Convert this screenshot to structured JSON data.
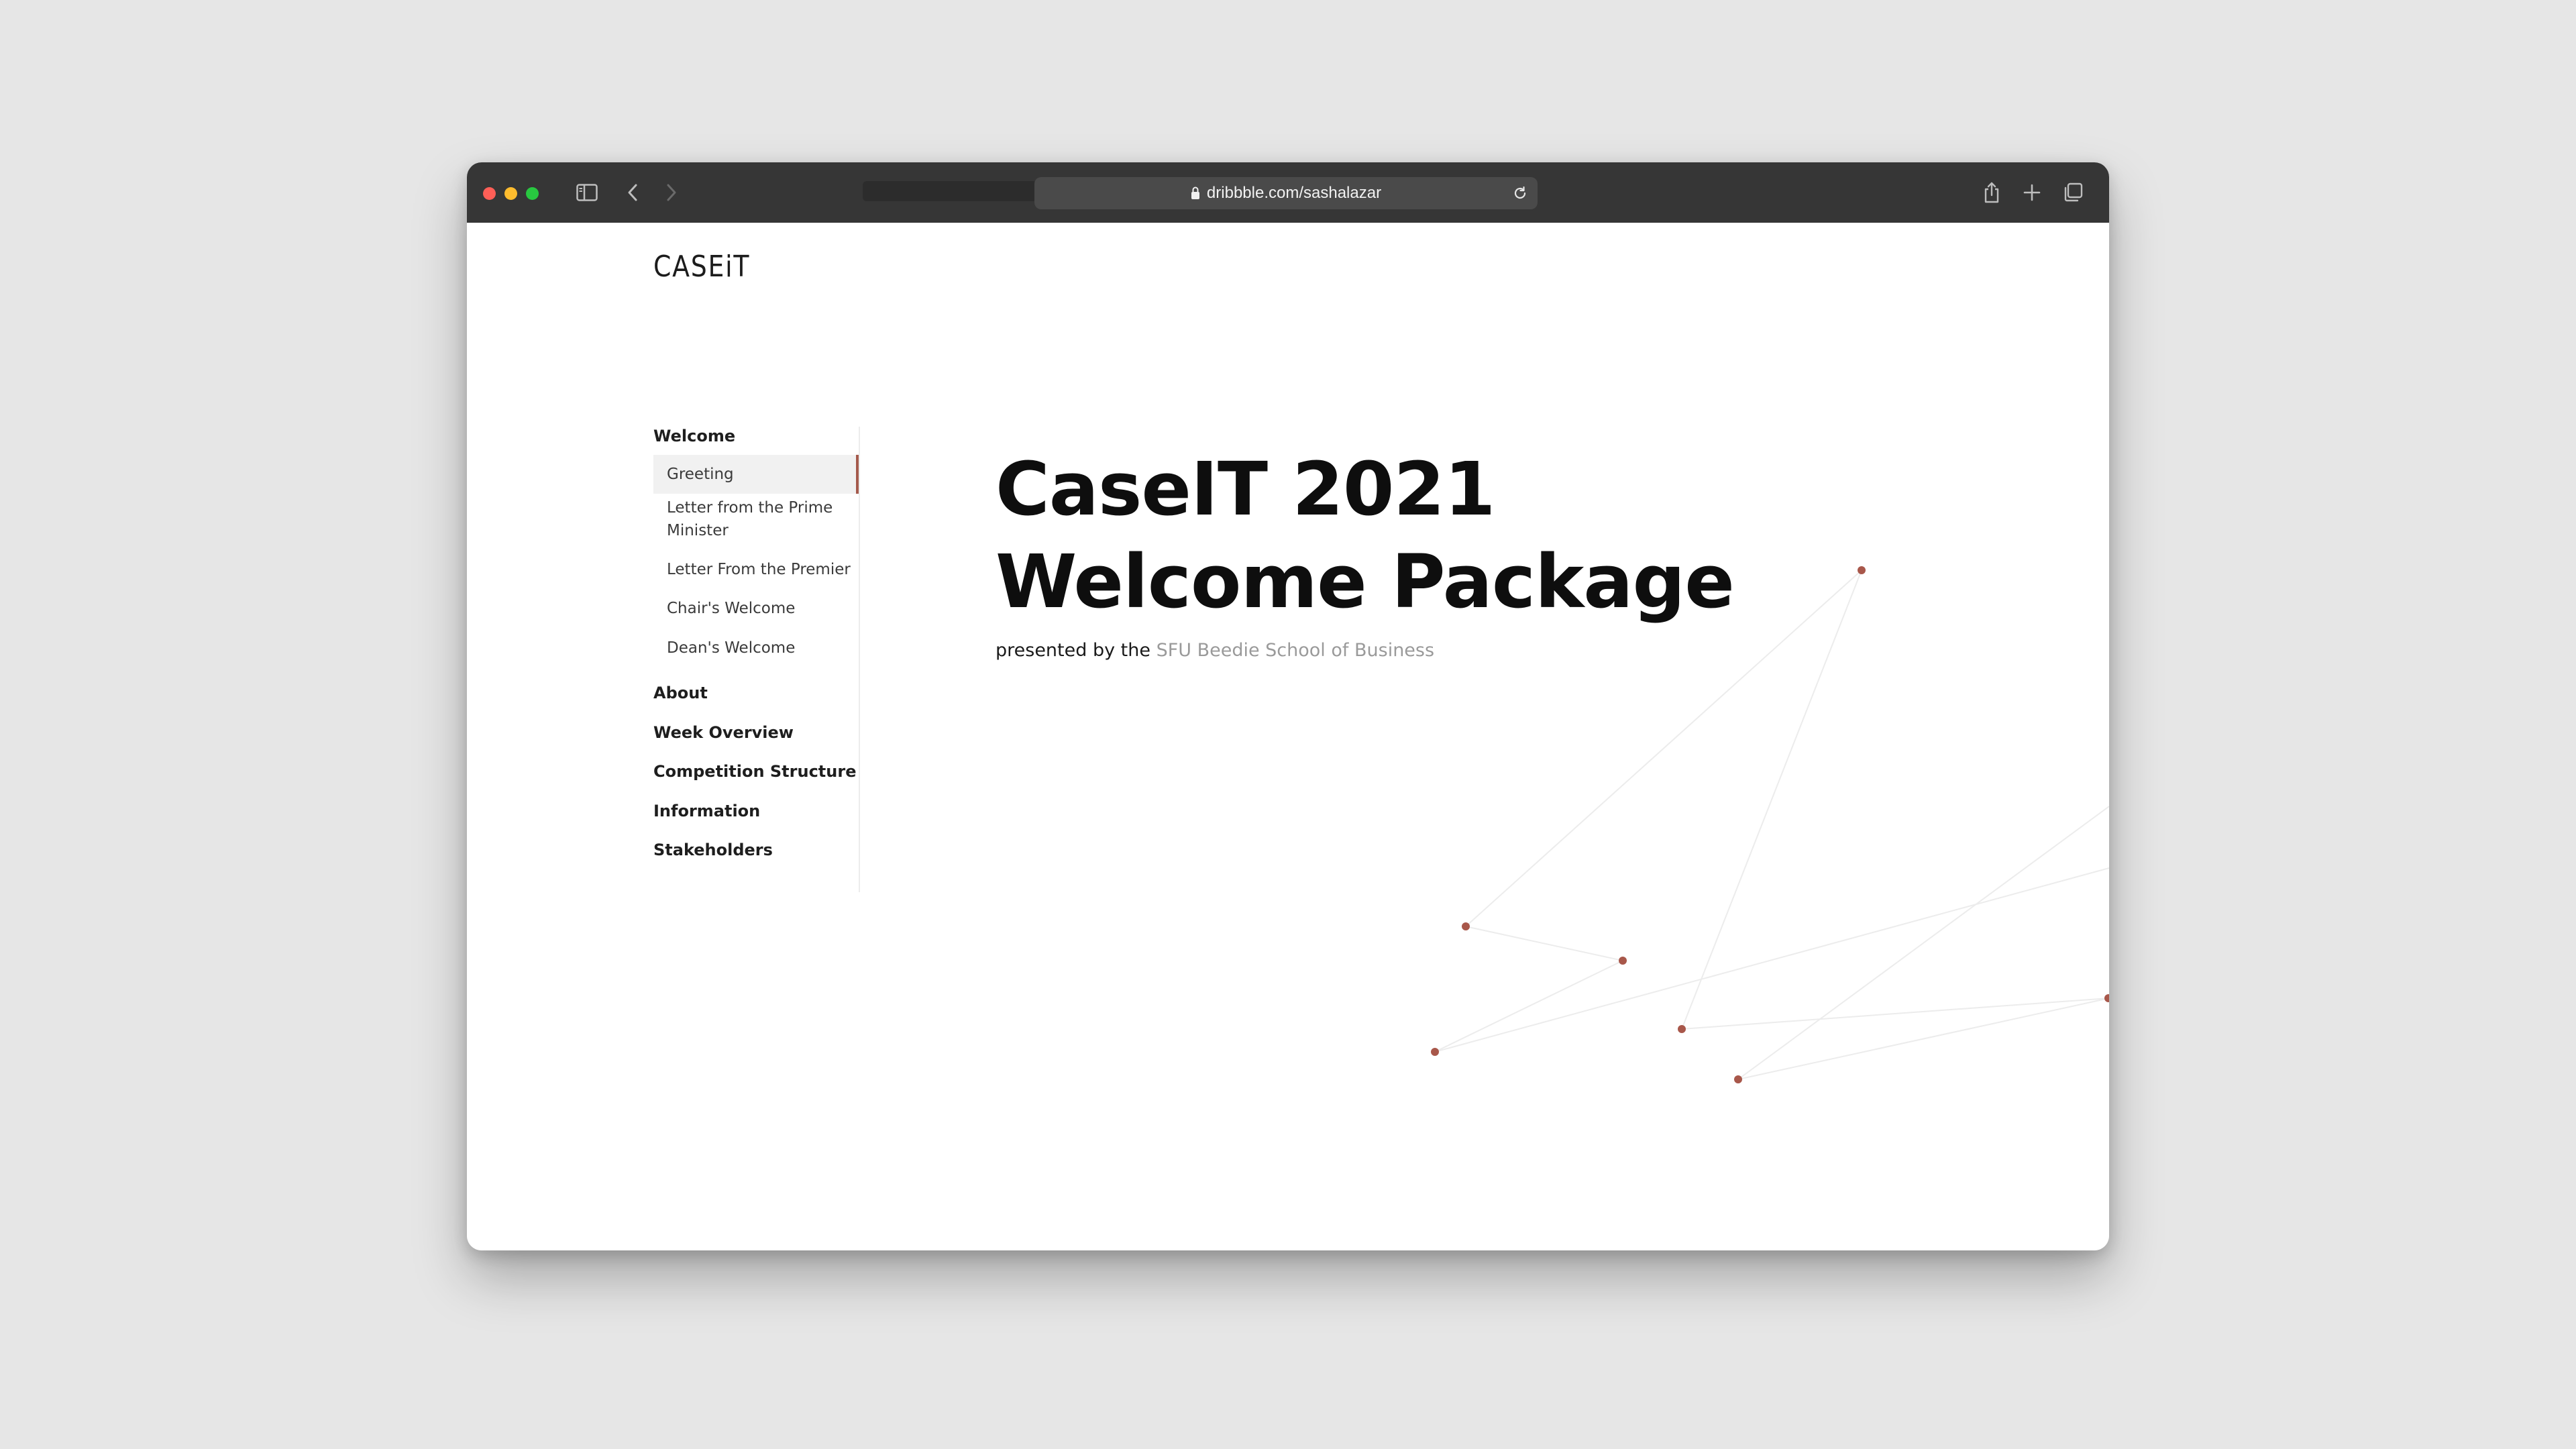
{
  "browser": {
    "url": "dribbble.com/sashalazar",
    "colors": {
      "close": "#ff5f57",
      "minimize": "#febc2e",
      "zoom": "#28c840"
    },
    "icons": [
      "sidebar-icon",
      "back-icon",
      "forward-icon",
      "lock-icon",
      "reload-icon",
      "share-icon",
      "new-tab-icon",
      "tabs-overview-icon"
    ]
  },
  "site": {
    "logo": "CASEiT"
  },
  "nav": {
    "sections": [
      {
        "label": "Welcome"
      },
      {
        "label": "About"
      },
      {
        "label": "Week Overview"
      },
      {
        "label": "Competition Structure"
      },
      {
        "label": "Information"
      },
      {
        "label": "Stakeholders"
      }
    ],
    "welcome_items": [
      {
        "label": "Greeting",
        "active": true
      },
      {
        "label": "Letter from the Prime Minister"
      },
      {
        "label": "Letter From the Premier"
      },
      {
        "label": "Chair's Welcome"
      },
      {
        "label": "Dean's Welcome"
      }
    ]
  },
  "hero": {
    "title": "CaseIT 2021 Welcome Package",
    "presented_prefix": "presented by the",
    "presented_link": "SFU Beedie School of Business"
  },
  "theme": {
    "accent": "#a45a4c",
    "node_color": "#a8574a",
    "line_color": "#ececec"
  }
}
